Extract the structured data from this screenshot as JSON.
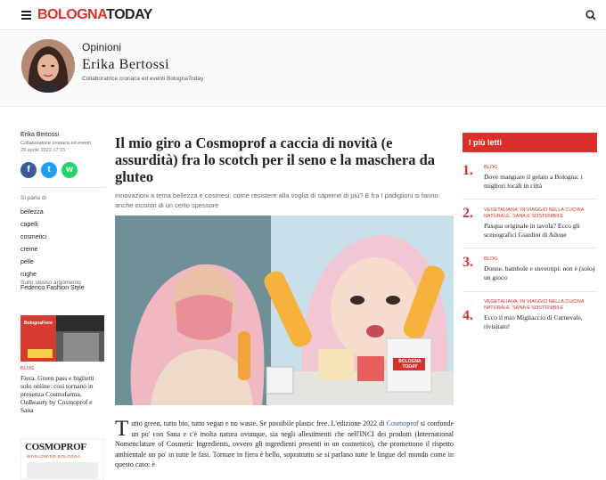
{
  "header": {
    "logo_part1": "BOLOGNA",
    "logo_part2": "TODAY"
  },
  "author_band": {
    "section": "Opinioni",
    "name": "Erika Bertossi",
    "role": "Collaboratrice cronaca ed eventi BolognaToday"
  },
  "article_meta": {
    "author": "Erika Bertossi",
    "role": "Collaboratrice cronaca ed eventi",
    "date": "28 aprile 2022 17:15"
  },
  "share": {
    "facebook": "f",
    "twitter": "t",
    "whatsapp": "w"
  },
  "topics": {
    "heading": "Si parla di",
    "tags": [
      "bellezza",
      "capelli",
      "cosmetici",
      "creme",
      "pelle",
      "rughe",
      "Federico Fashion Style"
    ]
  },
  "related": {
    "heading": "Sullo stesso argomento",
    "badge": "BLOG",
    "title": "Fiera. Green pass e biglietti solo online: così tornano in presenza Cosmofarma, OnBeauty by Cosmoprof e Sana",
    "img1_caption": "BolognaFiere",
    "img2_logo": "COSMOPROF",
    "img2_sub": "WORLDWIDE BOLOGNA"
  },
  "article": {
    "title": "Il mio giro a Cosmoprof a caccia di novità (e assurdità) fra lo scotch per il seno e la maschera da gluteo",
    "subtitle": "Innovazioni a tema bellezza e cosmesi: come resistere alla voglia di saperne di più? E fra I padiglioni si fanno anche incontri di un certo spessore",
    "image_box_text": "BOLOGNA TODAY",
    "dropcap": "T",
    "p1_a": "utto green, tutto bio, tutto vegan e no waste. Se possibile plastic free. L'edizione 2022 di ",
    "p1_link": "Cosmoprof",
    "p1_b": " si confonde un po' con Sana e c'è molta natura ovunque, sia negli allestimenti che nell'INCI dei prodotti (International Nomenclature of Cosmetic Ingredients, ovvero gli ingredienti presenti in un cosmetico), che promettono il rispetto ambientale un po' in tutte le fasi. Tornare in fiera è bello, soprattutto se si parlano tutte le lingue del mondo come in questo caso: è"
  },
  "most_read": {
    "heading": "I più letti",
    "items": [
      {
        "num": "1.",
        "category": "BLOG",
        "title": "Dove mangiare il gelato a Bologna: i migliori locali in città"
      },
      {
        "num": "2.",
        "category": "VEGETALIANA. IN VIAGGIO NELLA CUCINA NATURALE, SANA E SOSTENIBILE",
        "title": "Pasqua originale in tavola? Ecco gli scenografici Giardini di Adone"
      },
      {
        "num": "3.",
        "category": "BLOG",
        "title": "Donne, bambole e stereotipi: non è (solo) un gioco"
      },
      {
        "num": "4.",
        "category": "VEGETALIANA. IN VIAGGIO NELLA CUCINA NATURALE, SANA E SOSTENIBILE",
        "title": "Ecco il mio Migliaccio di Carnevale, rivisitato!"
      }
    ]
  },
  "colors": {
    "brand_red": "#d9302c",
    "link_blue": "#2d4d8f",
    "facebook": "#3b5a9a",
    "twitter": "#1da1f2",
    "whatsapp": "#25d366"
  },
  "icons": [
    "menu-icon",
    "search-icon",
    "facebook-icon",
    "twitter-icon",
    "whatsapp-icon"
  ]
}
